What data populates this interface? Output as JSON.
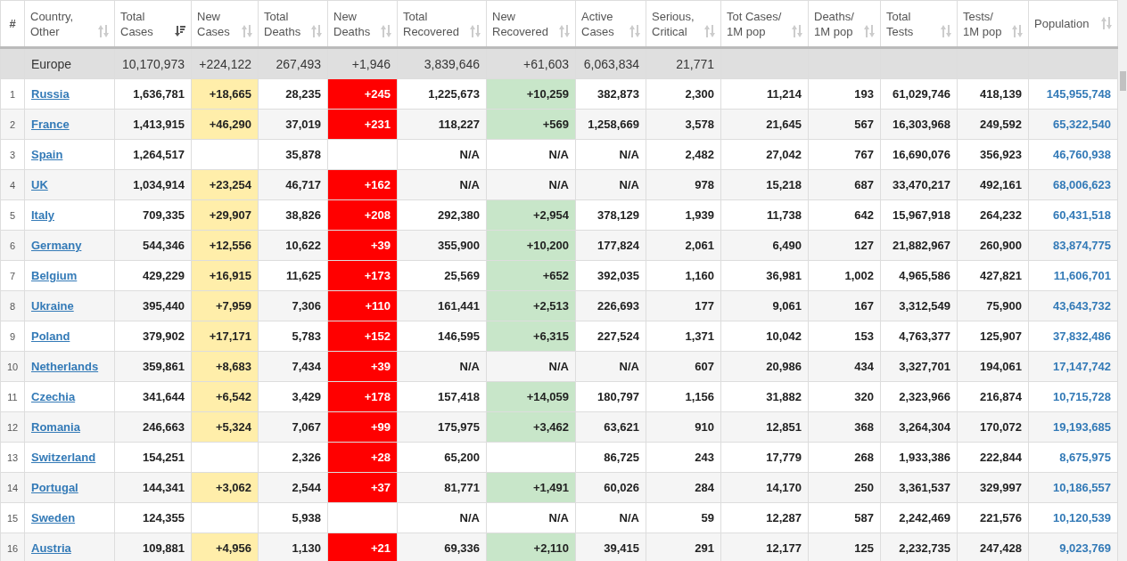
{
  "columns": [
    {
      "label": "#",
      "kind": "rank"
    },
    {
      "label": "Country,\nOther",
      "kind": "country",
      "sorted": false
    },
    {
      "label": "Total\nCases",
      "kind": "plain",
      "sorted": true
    },
    {
      "label": "New\nCases",
      "kind": "new-cases",
      "sorted": false
    },
    {
      "label": "Total\nDeaths",
      "kind": "plain",
      "sorted": false
    },
    {
      "label": "New\nDeaths",
      "kind": "new-deaths",
      "sorted": false
    },
    {
      "label": "Total\nRecovered",
      "kind": "plain",
      "sorted": false
    },
    {
      "label": "New\nRecovered",
      "kind": "new-recovered",
      "sorted": false
    },
    {
      "label": "Active\nCases",
      "kind": "plain",
      "sorted": false
    },
    {
      "label": "Serious,\nCritical",
      "kind": "plain",
      "sorted": false
    },
    {
      "label": "Tot Cases/\n1M pop",
      "kind": "plain",
      "sorted": false
    },
    {
      "label": "Deaths/\n1M pop",
      "kind": "plain",
      "sorted": false
    },
    {
      "label": "Total\nTests",
      "kind": "plain",
      "sorted": false
    },
    {
      "label": "Tests/\n1M pop",
      "kind": "plain",
      "sorted": false
    },
    {
      "label": "Population",
      "kind": "population",
      "sorted": false
    }
  ],
  "total_row": {
    "name": "Europe",
    "cells": [
      "10,170,973",
      "+224,122",
      "267,493",
      "+1,946",
      "3,839,646",
      "+61,603",
      "6,063,834",
      "21,771",
      null,
      null,
      null,
      null,
      null
    ]
  },
  "rows": [
    {
      "rank": "1",
      "country": "Russia",
      "cells": [
        "1,636,781",
        "+18,665",
        "28,235",
        "+245",
        "1,225,673",
        "+10,259",
        "382,873",
        "2,300",
        "11,214",
        "193",
        "61,029,746",
        "418,139",
        "145,955,748"
      ]
    },
    {
      "rank": "2",
      "country": "France",
      "cells": [
        "1,413,915",
        "+46,290",
        "37,019",
        "+231",
        "118,227",
        "+569",
        "1,258,669",
        "3,578",
        "21,645",
        "567",
        "16,303,968",
        "249,592",
        "65,322,540"
      ]
    },
    {
      "rank": "3",
      "country": "Spain",
      "cells": [
        "1,264,517",
        null,
        "35,878",
        null,
        "N/A",
        "N/A",
        "N/A",
        "2,482",
        "27,042",
        "767",
        "16,690,076",
        "356,923",
        "46,760,938"
      ]
    },
    {
      "rank": "4",
      "country": "UK",
      "cells": [
        "1,034,914",
        "+23,254",
        "46,717",
        "+162",
        "N/A",
        "N/A",
        "N/A",
        "978",
        "15,218",
        "687",
        "33,470,217",
        "492,161",
        "68,006,623"
      ]
    },
    {
      "rank": "5",
      "country": "Italy",
      "cells": [
        "709,335",
        "+29,907",
        "38,826",
        "+208",
        "292,380",
        "+2,954",
        "378,129",
        "1,939",
        "11,738",
        "642",
        "15,967,918",
        "264,232",
        "60,431,518"
      ]
    },
    {
      "rank": "6",
      "country": "Germany",
      "cells": [
        "544,346",
        "+12,556",
        "10,622",
        "+39",
        "355,900",
        "+10,200",
        "177,824",
        "2,061",
        "6,490",
        "127",
        "21,882,967",
        "260,900",
        "83,874,775"
      ]
    },
    {
      "rank": "7",
      "country": "Belgium",
      "cells": [
        "429,229",
        "+16,915",
        "11,625",
        "+173",
        "25,569",
        "+652",
        "392,035",
        "1,160",
        "36,981",
        "1,002",
        "4,965,586",
        "427,821",
        "11,606,701"
      ]
    },
    {
      "rank": "8",
      "country": "Ukraine",
      "cells": [
        "395,440",
        "+7,959",
        "7,306",
        "+110",
        "161,441",
        "+2,513",
        "226,693",
        "177",
        "9,061",
        "167",
        "3,312,549",
        "75,900",
        "43,643,732"
      ]
    },
    {
      "rank": "9",
      "country": "Poland",
      "cells": [
        "379,902",
        "+17,171",
        "5,783",
        "+152",
        "146,595",
        "+6,315",
        "227,524",
        "1,371",
        "10,042",
        "153",
        "4,763,377",
        "125,907",
        "37,832,486"
      ]
    },
    {
      "rank": "10",
      "country": "Netherlands",
      "cells": [
        "359,861",
        "+8,683",
        "7,434",
        "+39",
        "N/A",
        "N/A",
        "N/A",
        "607",
        "20,986",
        "434",
        "3,327,701",
        "194,061",
        "17,147,742"
      ]
    },
    {
      "rank": "11",
      "country": "Czechia",
      "cells": [
        "341,644",
        "+6,542",
        "3,429",
        "+178",
        "157,418",
        "+14,059",
        "180,797",
        "1,156",
        "31,882",
        "320",
        "2,323,966",
        "216,874",
        "10,715,728"
      ]
    },
    {
      "rank": "12",
      "country": "Romania",
      "cells": [
        "246,663",
        "+5,324",
        "7,067",
        "+99",
        "175,975",
        "+3,462",
        "63,621",
        "910",
        "12,851",
        "368",
        "3,264,304",
        "170,072",
        "19,193,685"
      ]
    },
    {
      "rank": "13",
      "country": "Switzerland",
      "cells": [
        "154,251",
        null,
        "2,326",
        "+28",
        "65,200",
        null,
        "86,725",
        "243",
        "17,779",
        "268",
        "1,933,386",
        "222,844",
        "8,675,975"
      ]
    },
    {
      "rank": "14",
      "country": "Portugal",
      "cells": [
        "144,341",
        "+3,062",
        "2,544",
        "+37",
        "81,771",
        "+1,491",
        "60,026",
        "284",
        "14,170",
        "250",
        "3,361,537",
        "329,997",
        "10,186,557"
      ]
    },
    {
      "rank": "15",
      "country": "Sweden",
      "cells": [
        "124,355",
        null,
        "5,938",
        null,
        "N/A",
        "N/A",
        "N/A",
        "59",
        "12,287",
        "587",
        "2,242,469",
        "221,576",
        "10,120,539"
      ]
    },
    {
      "rank": "16",
      "country": "Austria",
      "cells": [
        "109,881",
        "+4,956",
        "1,130",
        "+21",
        "69,336",
        "+2,110",
        "39,415",
        "291",
        "12,177",
        "125",
        "2,232,735",
        "247,428",
        "9,023,769"
      ]
    }
  ]
}
